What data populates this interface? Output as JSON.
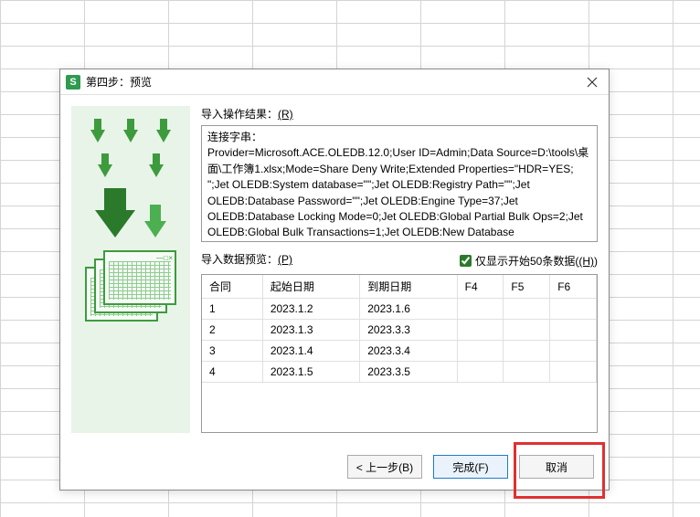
{
  "dialog": {
    "title": "第四步：预览",
    "icon_letter": "S"
  },
  "labels": {
    "result": "导入操作结果：",
    "result_key": "(R)",
    "preview": "导入数据预览：",
    "preview_key": "(P)",
    "checkbox": "仅显示开始50条数据",
    "checkbox_key": "(H)"
  },
  "result_text": {
    "line1": "连接字串：",
    "line2": "Provider=Microsoft.ACE.OLEDB.12.0;User ID=Admin;Data Source=D:\\tools\\桌面\\工作簿1.xlsx;Mode=Share Deny Write;Extended Properties=\"HDR=YES; \";Jet OLEDB:System database=\"\";Jet OLEDB:Registry Path=\"\";Jet OLEDB:Database Password=\"\";Jet OLEDB:Engine Type=37;Jet OLEDB:Database Locking Mode=0;Jet OLEDB:Global Partial Bulk Ops=2;Jet OLEDB:Global Bulk Transactions=1;Jet OLEDB:New Database Password=\"\";Jet"
  },
  "table": {
    "headers": [
      "合同",
      "起始日期",
      "到期日期",
      "F4",
      "F5",
      "F6"
    ],
    "rows": [
      [
        "1",
        "2023.1.2",
        "2023.1.6",
        "",
        "",
        ""
      ],
      [
        "2",
        "2023.1.3",
        "2023.3.3",
        "",
        "",
        ""
      ],
      [
        "3",
        "2023.1.4",
        "2023.3.4",
        "",
        "",
        ""
      ],
      [
        "4",
        "2023.1.5",
        "2023.3.5",
        "",
        "",
        ""
      ]
    ]
  },
  "buttons": {
    "back": "< 上一步(B)",
    "finish": "完成(F)",
    "cancel": "取消"
  },
  "checkbox_checked": true
}
